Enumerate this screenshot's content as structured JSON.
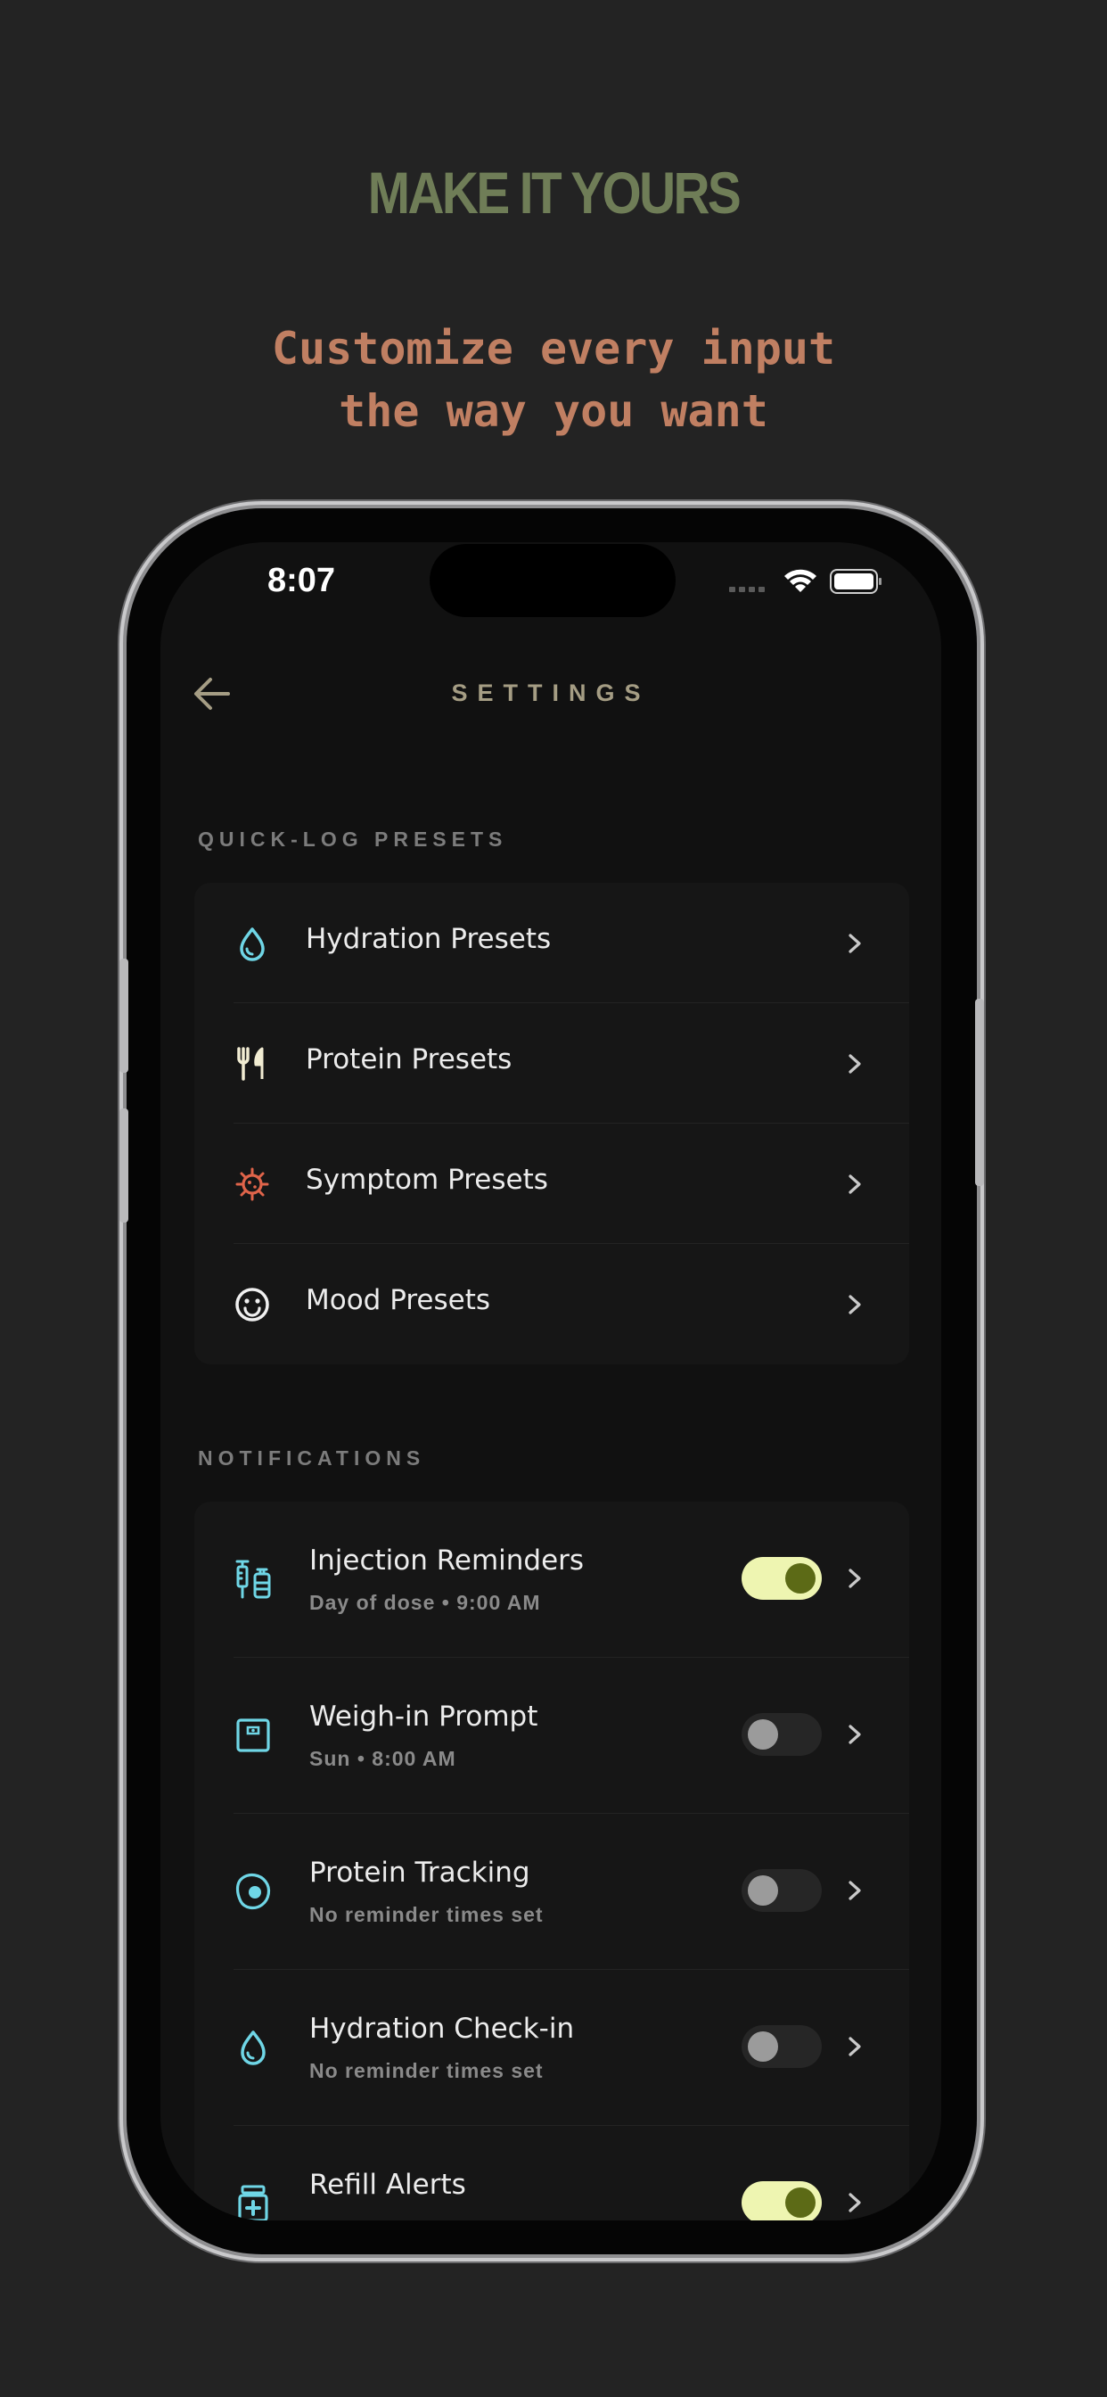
{
  "promo": {
    "headline": "MAKE IT YOURS",
    "subline_1": "Customize every input",
    "subline_2": "the way you want"
  },
  "status_bar": {
    "time": "8:07",
    "icons": [
      "cellular-icon",
      "wifi-icon",
      "battery-icon"
    ]
  },
  "header": {
    "title": "SETTINGS",
    "back_icon": "arrow-left-icon"
  },
  "quick_log": {
    "section_title": "QUICK-LOG PRESETS",
    "items": [
      {
        "label": "Hydration Presets",
        "icon": "water-drop-icon",
        "icon_color": "#6fd6e6"
      },
      {
        "label": "Protein Presets",
        "icon": "fork-knife-icon",
        "icon_color": "#f1ecd2"
      },
      {
        "label": "Symptom Presets",
        "icon": "virus-icon",
        "icon_color": "#e0644a"
      },
      {
        "label": "Mood Presets",
        "icon": "smiley-icon",
        "icon_color": "#f0f0f0"
      }
    ]
  },
  "notifications": {
    "section_title": "NOTIFICATIONS",
    "items": [
      {
        "label": "Injection Reminders",
        "sublabel": "Day of dose • 9:00 AM",
        "enabled": true,
        "icon": "syringe-vial-icon"
      },
      {
        "label": "Weigh-in Prompt",
        "sublabel": "Sun • 8:00 AM",
        "enabled": false,
        "icon": "scale-icon"
      },
      {
        "label": "Protein Tracking",
        "sublabel": "No reminder times set",
        "enabled": false,
        "icon": "egg-icon"
      },
      {
        "label": "Hydration Check-in",
        "sublabel": "No reminder times set",
        "enabled": false,
        "icon": "water-drop-icon"
      },
      {
        "label": "Refill Alerts",
        "sublabel": "",
        "enabled": true,
        "icon": "pill-bottle-icon"
      }
    ]
  },
  "colors": {
    "background": "#232323",
    "headline": "#6f7d57",
    "subline": "#c07f62",
    "accent_icon": "#6fd6e6",
    "toggle_on_track": "#eef5b1",
    "toggle_on_knob": "#5c6a16"
  }
}
